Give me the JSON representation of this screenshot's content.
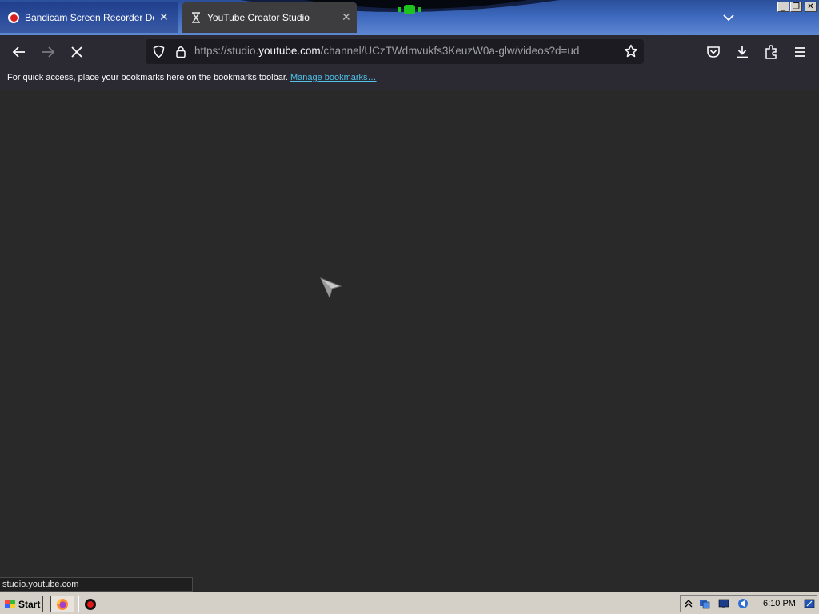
{
  "tabs": [
    {
      "title": "Bandicam Screen Recorder Downlo",
      "close": "✕",
      "active": false,
      "icon": "bandicam-record-icon"
    },
    {
      "title": "YouTube Creator Studio",
      "close": "✕",
      "active": true,
      "icon": "loading-hourglass-icon"
    }
  ],
  "window_controls": {
    "minimize": "_",
    "maximize": "❐",
    "close": "✕"
  },
  "address_bar": {
    "url_prefix": "https://studio.",
    "url_domain": "youtube.com",
    "url_suffix": "/channel/UCzTWdmvukfs3KeuzW0a-glw/videos?d=ud"
  },
  "bookmarks_bar": {
    "message": "For quick access, place your bookmarks here on the bookmarks toolbar.",
    "link": "Manage bookmarks…"
  },
  "status_panel": {
    "text": "studio.youtube.com"
  },
  "taskbar": {
    "start_label": "Start",
    "clock": "6:10 PM",
    "apps": [
      "firefox-icon",
      "bandicam-icon"
    ]
  },
  "colors": {
    "content_bg": "#292929",
    "toolbar_bg": "#2b2a33",
    "link": "#4fc2e8",
    "tabstrip": "#3c68bd"
  }
}
